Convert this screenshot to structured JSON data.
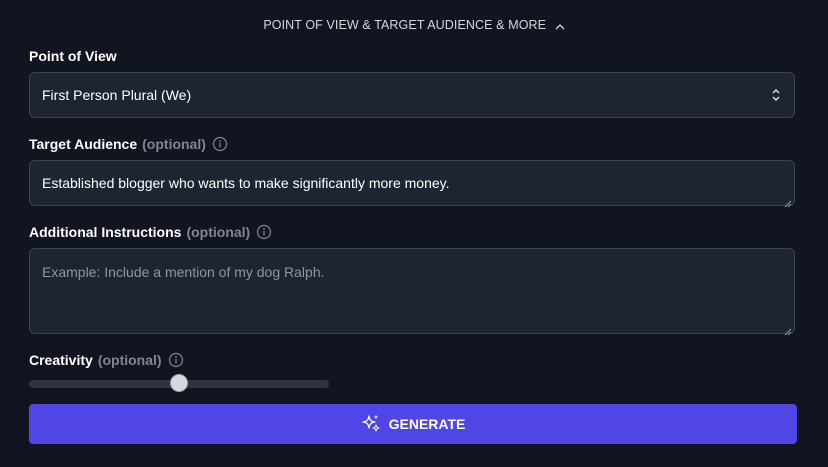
{
  "section_toggle": {
    "label": "POINT OF VIEW & TARGET AUDIENCE & MORE",
    "icon": "chevron-up-icon"
  },
  "point_of_view": {
    "label": "Point of View",
    "selected": "First Person Plural (We)",
    "icon": "select-updown-icon"
  },
  "target_audience": {
    "label": "Target Audience",
    "optional": "(optional)",
    "value": "Established blogger who wants to make significantly more money.",
    "icon": "info-icon"
  },
  "additional_instructions": {
    "label": "Additional Instructions",
    "optional": "(optional)",
    "placeholder": "Example: Include a mention of my dog Ralph.",
    "icon": "info-icon"
  },
  "creativity": {
    "label": "Creativity",
    "optional": "(optional)",
    "level": 0.5,
    "icon": "info-icon"
  },
  "generate": {
    "label": "GENERATE",
    "icon": "sparkles-icon"
  },
  "colors": {
    "background": "#121420",
    "field_bg": "#1e2532",
    "field_border": "#3b4453",
    "accent": "#4f46e5",
    "muted_text": "#7f8694"
  }
}
